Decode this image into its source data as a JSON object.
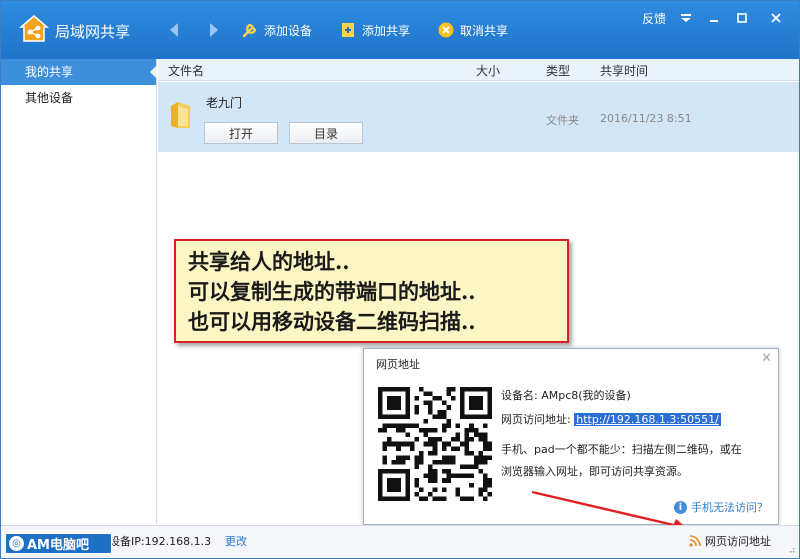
{
  "app": {
    "title": "局域网共享"
  },
  "toolbar": {
    "add_device": "添加设备",
    "add_share": "添加共享",
    "cancel_share": "取消共享"
  },
  "window_controls": {
    "feedback": "反馈"
  },
  "sidebar": {
    "items": [
      {
        "label": "我的共享",
        "active": true
      },
      {
        "label": "其他设备",
        "active": false
      }
    ]
  },
  "list": {
    "columns": {
      "name": "文件名",
      "size": "大小",
      "type": "类型",
      "time": "共享时间"
    },
    "rows": [
      {
        "name": "老九门",
        "open_label": "打开",
        "dir_label": "目录",
        "type": "文件夹",
        "time": "2016/11/23 8:51"
      }
    ]
  },
  "annotation": {
    "lines": [
      "共享给人的地址..",
      "可以复制生成的带端口的地址..",
      "也可以用移动设备二维码扫描.."
    ]
  },
  "popup": {
    "title": "网页地址",
    "device_name": "设备名: AMpc8(我的设备)",
    "url_label": "网页访问地址:",
    "url": "http://192.168.1.3:50551/",
    "desc_line1": "手机、pad一个都不能少：扫描左侧二维码，或在",
    "desc_line2": "浏览器输入网址，即可访问共享资源。",
    "help": "手机无法访问？"
  },
  "status": {
    "ip_label": "设备IP:192.168.1.3",
    "change": "更改",
    "web_address": "网页访问地址"
  },
  "watermark": {
    "text": "AM电脑吧"
  },
  "colors": {
    "titlebar": "#2680d6",
    "selected_row": "#d3e6f7",
    "annotation_border": "#d62222",
    "annotation_bg": "#fcf6c5",
    "link": "#2b7bd0"
  }
}
